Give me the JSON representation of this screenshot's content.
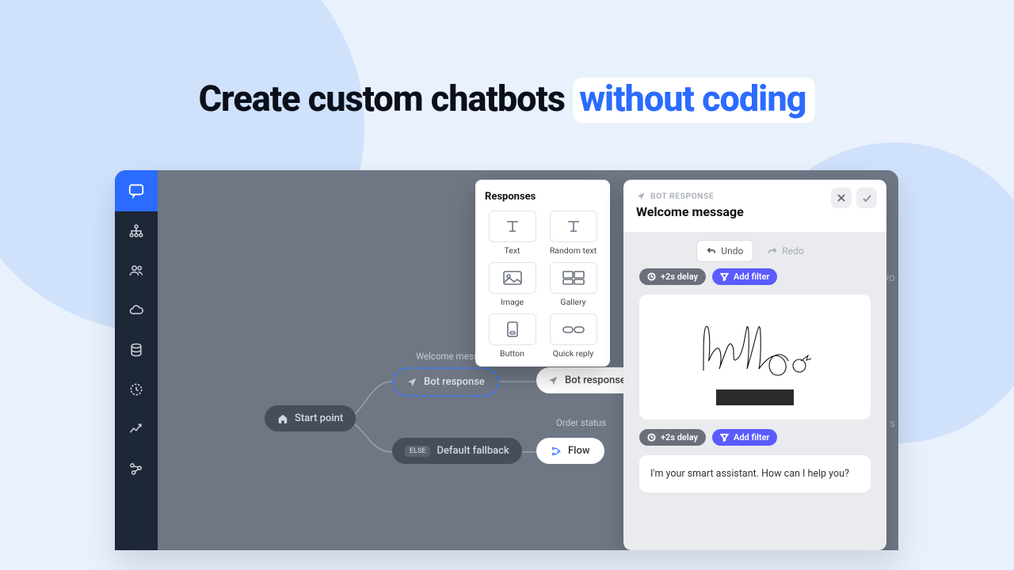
{
  "headline": {
    "a": "Create custom chatbots ",
    "b": "without coding"
  },
  "popover": {
    "title": "Responses",
    "items": {
      "text": "Text",
      "random": "Random text",
      "image": "Image",
      "gallery": "Gallery",
      "button": "Button",
      "quick": "Quick reply"
    }
  },
  "canvas": {
    "start": "Start point",
    "welcome_label": "Welcome message",
    "bot_response": "Bot response",
    "fallback": "Default fallback",
    "fallback_pill": "ELSE",
    "bot_response2": "Bot response",
    "order_label": "Order status",
    "flow": "Flow"
  },
  "panel": {
    "eyebrow": "BOT RESPONSE",
    "title": "Welcome message",
    "undo": "Undo",
    "redo": "Redo",
    "delay": "+2s delay",
    "filter": "Add filter",
    "message": "I'm your smart assistant. How can I help you?"
  },
  "stub1": "PRO",
  "stub2": "S"
}
